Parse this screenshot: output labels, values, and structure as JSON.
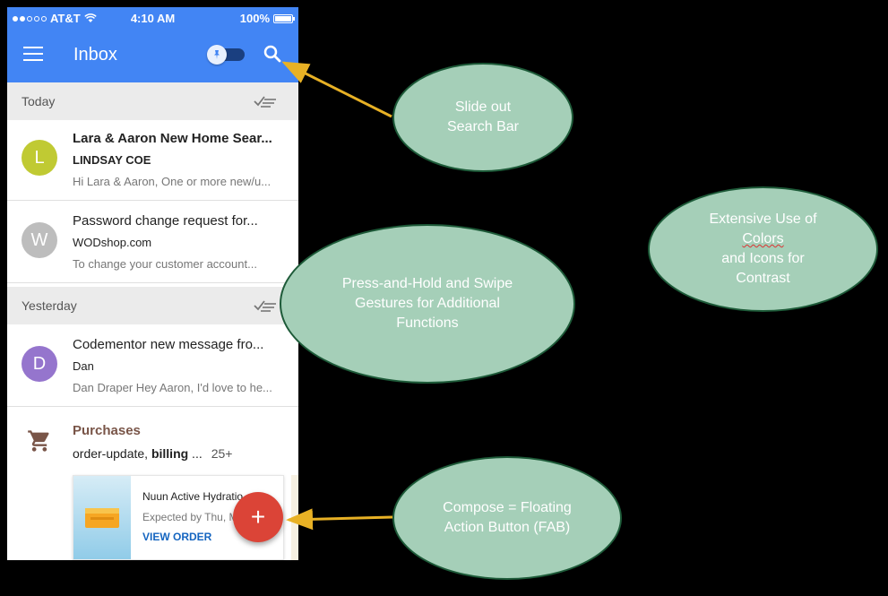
{
  "status_bar": {
    "carrier": "AT&T",
    "time": "4:10 AM",
    "battery": "100%"
  },
  "app_bar": {
    "title": "Inbox"
  },
  "sections": [
    {
      "label": "Today"
    },
    {
      "label": "Yesterday"
    }
  ],
  "emails": [
    {
      "avatar_letter": "L",
      "avatar_color": "#c0ca33",
      "subject": "Lara & Aaron New Home Sear...",
      "sender": "LINDSAY COE",
      "snippet": "Hi Lara & Aaron, One or more new/u...",
      "unread": true
    },
    {
      "avatar_letter": "W",
      "avatar_color": "#bdbdbd",
      "subject": "Password change request for...",
      "sender": "WODshop.com",
      "snippet": "To change your customer account...",
      "unread": false
    },
    {
      "avatar_letter": "D",
      "avatar_color": "#9575cd",
      "subject": "Codementor new message fro...",
      "sender": "Dan",
      "snippet": "Dan Draper Hey Aaron, I'd love to he...",
      "unread": false
    }
  ],
  "purchases": {
    "title": "Purchases",
    "line_prefix": "order-update, ",
    "line_bold": "billing",
    "line_suffix": " ...",
    "count": "25+",
    "order": {
      "name": "Nuun Active Hydratio",
      "expected": "Expected by Thu, M",
      "action": "VIEW ORDER"
    }
  },
  "fab": {
    "label": "+",
    "color": "#db4437"
  },
  "callouts": {
    "search": [
      "Slide out",
      "Search Bar"
    ],
    "press": [
      "Press-and-Hold and Swipe",
      "Gestures for Additional",
      "Functions"
    ],
    "colors_line1": "Extensive Use of",
    "colors_line2_a": "Colors",
    "colors_line2_b": " and Icons for",
    "colors_line3": "Contrast",
    "fab": [
      "Compose = Floating",
      "Action Button (FAB)"
    ]
  },
  "colors": {
    "app_bar": "#4285f4",
    "bubble_fill": "#a5cfb8",
    "bubble_border": "#1d5a38",
    "arrow": "#e8b125"
  }
}
